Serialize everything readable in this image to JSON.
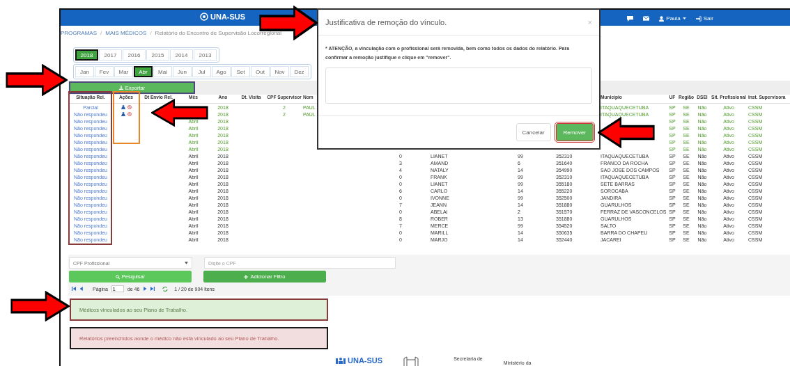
{
  "nav": {
    "logo": "UNA-SUS",
    "user": "Paula",
    "logout": "Sair"
  },
  "breadcrumb": [
    "PROGRAMAS",
    "MAIS MÉDICOS",
    "Relatório do Encontro de Supervisão Locorregional"
  ],
  "breadcrumb_separator": "/",
  "years": [
    {
      "label": "2018",
      "selected": true
    },
    {
      "label": "2017",
      "selected": false
    },
    {
      "label": "2016",
      "selected": false
    },
    {
      "label": "2015",
      "selected": false
    },
    {
      "label": "2014",
      "selected": false
    },
    {
      "label": "2013",
      "selected": false
    }
  ],
  "months": [
    {
      "label": "Jan",
      "selected": false
    },
    {
      "label": "Fev",
      "selected": false
    },
    {
      "label": "Mar",
      "selected": false
    },
    {
      "label": "Abr",
      "selected": true
    },
    {
      "label": "Mai",
      "selected": false
    },
    {
      "label": "Jun",
      "selected": false
    },
    {
      "label": "Jul",
      "selected": false
    },
    {
      "label": "Ago",
      "selected": false
    },
    {
      "label": "Set",
      "selected": false
    },
    {
      "label": "Out",
      "selected": false
    },
    {
      "label": "Nov",
      "selected": false
    },
    {
      "label": "Dez",
      "selected": false
    }
  ],
  "export_button": "Exportar",
  "table": {
    "columns_left": [
      "Situação Rel.",
      "Ações",
      "Dt Envio Rel.",
      "Mês",
      "Ano",
      "Dt. Visita",
      "CPF Supervisor",
      "Nom"
    ],
    "columns_right": [
      "Município",
      "UF",
      "Região",
      "DSEI",
      "Sit. Profissional",
      "Inst. Supervisora"
    ],
    "rows": [
      {
        "situacao": "Parcial",
        "actions": true,
        "linked": true,
        "ano": "2018",
        "cpf_supervisor": "2",
        "nome": "PAUL",
        "municipio": "ITAQUAQUECETUBA",
        "uf": "SP",
        "regiao": "SE",
        "dsei": "Não",
        "sit_profissional": "Ativo",
        "inst_supervisora": "CSSM"
      },
      {
        "situacao": "Não respondeu",
        "actions": true,
        "linked": true,
        "ano": "2018",
        "cpf_supervisor": "2",
        "nome": "PAUL",
        "municipio": "ITAQUAQUECETUBA",
        "uf": "SP",
        "regiao": "SE",
        "dsei": "Não",
        "sit_profissional": "Ativo",
        "inst_supervisora": "CSSM"
      },
      {
        "situacao": "Não respondeu",
        "actions": false,
        "linked": true,
        "mes": "Abril",
        "ano": "2018",
        "uf": "SP",
        "regiao": "SE",
        "dsei": "Não",
        "sit_profissional": "Ativo",
        "inst_supervisora": "CSSM"
      },
      {
        "situacao": "Não respondeu",
        "actions": false,
        "linked": true,
        "mes": "Abril",
        "ano": "2018",
        "uf": "SP",
        "regiao": "SE",
        "dsei": "Não",
        "sit_profissional": "Ativo",
        "inst_supervisora": "CSSM"
      },
      {
        "situacao": "Não respondeu",
        "actions": false,
        "linked": true,
        "mes": "Abril",
        "ano": "2018",
        "uf": "SP",
        "regiao": "SE",
        "dsei": "Não",
        "sit_profissional": "Ativo",
        "inst_supervisora": "CSSM"
      },
      {
        "situacao": "Não respondeu",
        "actions": false,
        "linked": true,
        "mes": "Abril",
        "ano": "2018",
        "uf": "SP",
        "regiao": "SE",
        "dsei": "Não",
        "sit_profissional": "Ativo",
        "inst_supervisora": "CSSM"
      },
      {
        "situacao": "Não respondeu",
        "actions": false,
        "linked": true,
        "mes": "Abril",
        "ano": "2018",
        "uf": "SP",
        "regiao": "SE",
        "dsei": "Não",
        "sit_profissional": "Ativo",
        "inst_supervisora": "CSSM"
      },
      {
        "situacao": "Não respondeu",
        "actions": false,
        "linked": false,
        "mes": "Abril",
        "ano": "2018",
        "column_a": "0",
        "column_b": "LIANET",
        "column_c": "99",
        "column_d": "352310",
        "municipio": "ITAQUAQUECETUBA",
        "uf": "SP",
        "regiao": "SE",
        "dsei": "Não",
        "sit_profissional": "Ativo",
        "inst_supervisora": "CSSM"
      },
      {
        "situacao": "Não respondeu",
        "actions": false,
        "linked": false,
        "mes": "Abril",
        "ano": "2018",
        "column_a": "3",
        "column_b": "AMAND",
        "column_c": "6",
        "column_d": "351640",
        "municipio": "FRANCO DA ROCHA",
        "uf": "SP",
        "regiao": "SE",
        "dsei": "Não",
        "sit_profissional": "Ativo",
        "inst_supervisora": "CSSM"
      },
      {
        "situacao": "Não respondeu",
        "actions": false,
        "linked": false,
        "mes": "Abril",
        "ano": "2018",
        "column_a": "4",
        "column_b": "NATALY",
        "column_c": "14",
        "column_d": "354990",
        "municipio": "SAO JOSE DOS CAMPOS",
        "uf": "SP",
        "regiao": "SE",
        "dsei": "Não",
        "sit_profissional": "Ativo",
        "inst_supervisora": "CSSM"
      },
      {
        "situacao": "Não respondeu",
        "actions": false,
        "linked": false,
        "mes": "Abril",
        "ano": "2018",
        "column_a": "0",
        "column_b": "FRANK",
        "column_c": "99",
        "column_d": "352310",
        "municipio": "ITAQUAQUECETUBA",
        "uf": "SP",
        "regiao": "SE",
        "dsei": "Não",
        "sit_profissional": "Ativo",
        "inst_supervisora": "CSSM"
      },
      {
        "situacao": "Não respondeu",
        "actions": false,
        "linked": false,
        "mes": "Abril",
        "ano": "2018",
        "column_a": "0",
        "column_b": "LIANET",
        "column_c": "99",
        "column_d": "355180",
        "municipio": "SETE BARRAS",
        "uf": "SP",
        "regiao": "SE",
        "dsei": "Não",
        "sit_profissional": "Ativo",
        "inst_supervisora": "CSSM"
      },
      {
        "situacao": "Não respondeu",
        "actions": false,
        "linked": false,
        "mes": "Abril",
        "ano": "2018",
        "column_a": "6",
        "column_b": "CARLO",
        "column_c": "14",
        "column_d": "355220",
        "municipio": "SOROCABA",
        "uf": "SP",
        "regiao": "SE",
        "dsei": "Não",
        "sit_profissional": "Ativo",
        "inst_supervisora": "CSSM"
      },
      {
        "situacao": "Não respondeu",
        "actions": false,
        "linked": false,
        "mes": "Abril",
        "ano": "2018",
        "column_a": "0",
        "column_b": "IVONNE",
        "column_c": "99",
        "column_d": "352500",
        "municipio": "JANDIRA",
        "uf": "SP",
        "regiao": "SE",
        "dsei": "Não",
        "sit_profissional": "Ativo",
        "inst_supervisora": "CSSM"
      },
      {
        "situacao": "Não respondeu",
        "actions": false,
        "linked": false,
        "mes": "Abril",
        "ano": "2018",
        "column_a": "7",
        "column_b": "JEANN",
        "column_c": "14",
        "column_d": "351880",
        "municipio": "GUARULHOS",
        "uf": "SP",
        "regiao": "SE",
        "dsei": "Não",
        "sit_profissional": "Ativo",
        "inst_supervisora": "CSSM"
      },
      {
        "situacao": "Não respondeu",
        "actions": false,
        "linked": false,
        "mes": "Abril",
        "ano": "2018",
        "column_a": "0",
        "column_b": "ABELAI",
        "column_c": "2",
        "column_d": "351570",
        "municipio": "FERRAZ DE VASCONCELOS",
        "uf": "SP",
        "regiao": "SE",
        "dsei": "Não",
        "sit_profissional": "Ativo",
        "inst_supervisora": "CSSM"
      },
      {
        "situacao": "Não respondeu",
        "actions": false,
        "linked": false,
        "mes": "Abril",
        "ano": "2018",
        "column_a": "8",
        "column_b": "ROBER",
        "column_c": "13",
        "column_d": "351880",
        "municipio": "GUARULHOS",
        "uf": "SP",
        "regiao": "SE",
        "dsei": "Não",
        "sit_profissional": "Ativo",
        "inst_supervisora": "CSSM"
      },
      {
        "situacao": "Não respondeu",
        "actions": false,
        "linked": false,
        "mes": "Abril",
        "ano": "2018",
        "column_a": "7",
        "column_b": "MERCE",
        "column_c": "99",
        "column_d": "354520",
        "municipio": "SALTO",
        "uf": "SP",
        "regiao": "SE",
        "dsei": "Não",
        "sit_profissional": "Ativo",
        "inst_supervisora": "CSSM"
      },
      {
        "situacao": "Não respondeu",
        "actions": false,
        "linked": false,
        "mes": "Abril",
        "ano": "2018",
        "column_a": "0",
        "column_b": "MARILL",
        "column_c": "14",
        "column_d": "350635",
        "municipio": "BARRA DO CHAPEU",
        "uf": "SP",
        "regiao": "SE",
        "dsei": "Não",
        "sit_profissional": "Ativo",
        "inst_supervisora": "CSSM"
      },
      {
        "situacao": "Não respondeu",
        "actions": false,
        "linked": false,
        "mes": "Abril",
        "ano": "2018",
        "column_a": "0",
        "column_b": "MARJO",
        "column_c": "14",
        "column_d": "352440",
        "municipio": "JACAREI",
        "uf": "SP",
        "regiao": "SE",
        "dsei": "Não",
        "sit_profissional": "Ativo",
        "inst_supervisora": "CSSM"
      }
    ]
  },
  "filter": {
    "field_select": "CPF Profissional",
    "placeholder": "Digite o CPF",
    "search_button": "Pesquisar",
    "add_filter_button": "Adicionar Filtro"
  },
  "pager": {
    "page_label": "Página",
    "page": "1",
    "of": "de 46",
    "summary": "1 / 20 de 904 itens"
  },
  "legend": [
    {
      "kind": "linked",
      "text": "Médicos vinculados ao seu Plano de Trabalho."
    },
    {
      "kind": "unlinked",
      "text": "Relatórios preenchidos aonde o médico não está vinculado ao seu Plano de Trabalho."
    }
  ],
  "modal": {
    "title": "Justificativa de remoção do vínculo.",
    "close": "×",
    "message": "* ATENÇÃO, a vinculação com o profissional será removida, bem como todos os dados do relatório. Para confirmar a remoção justifique e clique em \"remover\".",
    "cancel_button": "Cancelar",
    "confirm_button": "Remover"
  },
  "footer": {
    "logo": "UNA-SUS",
    "secretaria": "Secretaria de",
    "ministerio": "Ministério da"
  }
}
